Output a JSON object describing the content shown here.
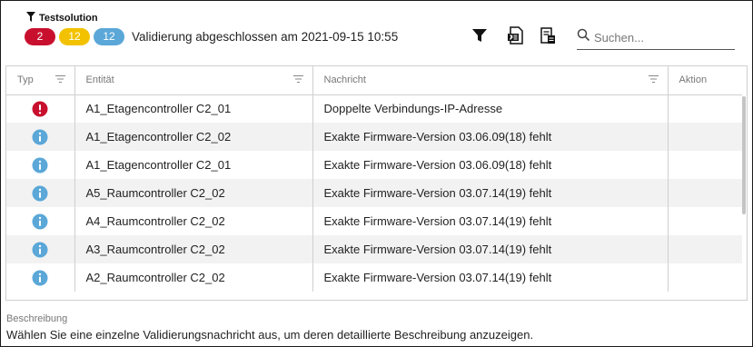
{
  "header": {
    "title": "Testsolution",
    "badges": {
      "error": "2",
      "warning": "12",
      "info": "12"
    },
    "status": "Validierung abgeschlossen am 2021-09-15 10:55"
  },
  "toolbar": {
    "filter_icon": "filter-icon",
    "export_excel_icon": "excel-export-icon",
    "export_pdf_icon": "document-export-icon"
  },
  "search": {
    "placeholder": "Suchen..."
  },
  "table": {
    "columns": {
      "type": "Typ",
      "entity": "Entität",
      "message": "Nachricht",
      "action": "Aktion"
    },
    "rows": [
      {
        "type": "error",
        "entity": "A1_Etagencontroller C2_01",
        "message": "Doppelte Verbindungs-IP-Adresse",
        "action": ""
      },
      {
        "type": "info",
        "entity": "A1_Etagencontroller C2_02",
        "message": "Exakte Firmware-Version 03.06.09(18) fehlt",
        "action": ""
      },
      {
        "type": "info",
        "entity": "A1_Etagencontroller C2_01",
        "message": "Exakte Firmware-Version 03.06.09(18) fehlt",
        "action": ""
      },
      {
        "type": "info",
        "entity": "A5_Raumcontroller C2_02",
        "message": "Exakte Firmware-Version 03.07.14(19) fehlt",
        "action": ""
      },
      {
        "type": "info",
        "entity": "A4_Raumcontroller C2_02",
        "message": "Exakte Firmware-Version 03.07.14(19) fehlt",
        "action": ""
      },
      {
        "type": "info",
        "entity": "A3_Raumcontroller C2_02",
        "message": "Exakte Firmware-Version 03.07.14(19) fehlt",
        "action": ""
      },
      {
        "type": "info",
        "entity": "A2_Raumcontroller C2_02",
        "message": "Exakte Firmware-Version 03.07.14(19) fehlt",
        "action": ""
      }
    ]
  },
  "description": {
    "label": "Beschreibung",
    "text": "Wählen Sie eine einzelne Validierungsnachricht aus, um deren detaillierte Beschreibung anzuzeigen."
  },
  "colors": {
    "error": "#c8102e",
    "warning": "#f2c200",
    "info": "#5aa7d8"
  }
}
